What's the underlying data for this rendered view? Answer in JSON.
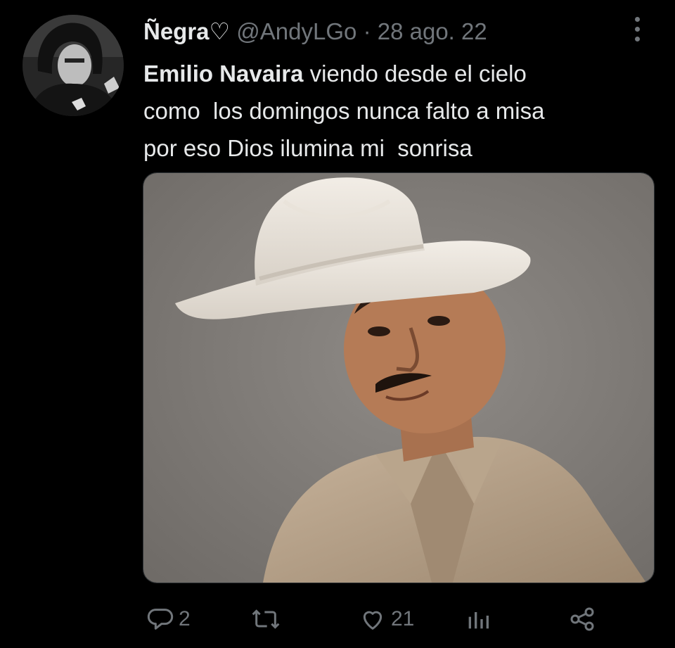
{
  "tweet": {
    "display_name": "Ñegra♡",
    "handle": "@AndyLGo",
    "separator": "·",
    "date": "28 ago. 22",
    "text": {
      "mention": "Emilio Navaira",
      "line1_rest": " viendo desde el cielo",
      "line2": "como  los domingos nunca falto a misa",
      "line3": "por eso Dios ilumina mi  sonrisa"
    }
  },
  "actions": {
    "replies": "2",
    "retweets": "",
    "likes": "21"
  },
  "icons": {
    "reply": "reply-icon",
    "retweet": "retweet-icon",
    "like": "heart-icon",
    "views": "analytics-icon",
    "share": "share-icon",
    "more": "more-dots-icon"
  },
  "colors": {
    "background": "#000000",
    "primary_text": "#e7e9ea",
    "secondary_text": "#71767b"
  }
}
